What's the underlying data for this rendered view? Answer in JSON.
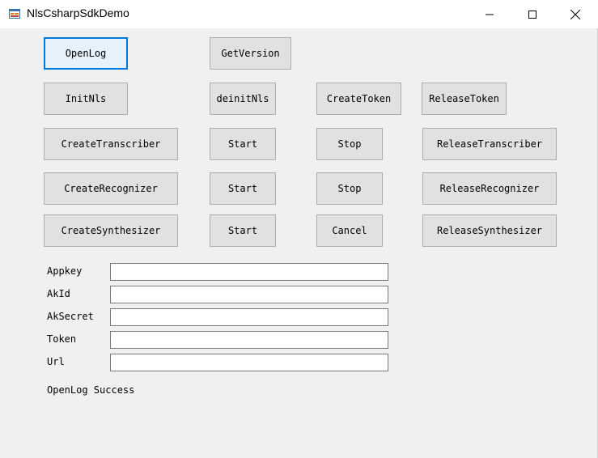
{
  "window": {
    "title": "NlsCsharpSdkDemo",
    "icons": {
      "app": "app-form-icon",
      "minimize": "minimize-icon",
      "maximize": "maximize-icon",
      "close": "close-icon"
    }
  },
  "buttons": {
    "open_log": "OpenLog",
    "get_version": "GetVersion",
    "init_nls": "InitNls",
    "deinit_nls": "deinitNls",
    "create_token": "CreateToken",
    "release_token": "ReleaseToken",
    "create_transcriber": "CreateTranscriber",
    "transcriber_start": "Start",
    "transcriber_stop": "Stop",
    "release_transcriber": "ReleaseTranscriber",
    "create_recognizer": "CreateRecognizer",
    "recognizer_start": "Start",
    "recognizer_stop": "Stop",
    "release_recognizer": "ReleaseRecognizer",
    "create_synthesizer": "CreateSynthesizer",
    "synthesizer_start": "Start",
    "synthesizer_cancel": "Cancel",
    "release_synthesizer": "ReleaseSynthesizer"
  },
  "fields": {
    "appkey": {
      "label": "Appkey",
      "value": ""
    },
    "akid": {
      "label": "AkId",
      "value": ""
    },
    "aksecret": {
      "label": "AkSecret",
      "value": ""
    },
    "token": {
      "label": "Token",
      "value": ""
    },
    "url": {
      "label": "Url",
      "value": ""
    }
  },
  "status_text": "OpenLog Success"
}
